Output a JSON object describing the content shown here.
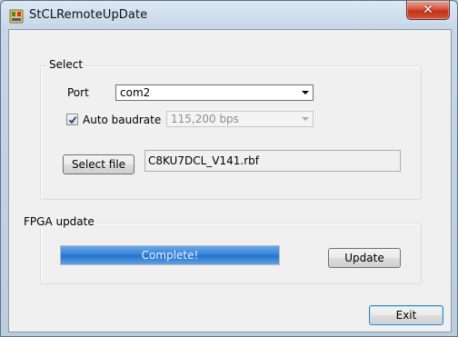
{
  "window": {
    "title": "StCLRemoteUpDate",
    "close_icon": "close-icon",
    "app_icon": "app-icon"
  },
  "select_group": {
    "label": "Select",
    "port_label": "Port",
    "port_value": "com2",
    "auto_baudrate_label": "Auto baudrate",
    "auto_baudrate_checked": true,
    "baudrate_value": "115,200  bps",
    "select_file_button": "Select file",
    "file_name": "C8KU7DCL_V141.rbf"
  },
  "fpga_group": {
    "label": "FPGA update",
    "progress_text": "Complete!",
    "progress_percent": 100,
    "update_button": "Update"
  },
  "footer": {
    "exit_button": "Exit"
  },
  "colors": {
    "progress_fill": "#2f7fd6",
    "close_button": "#c2311b"
  }
}
